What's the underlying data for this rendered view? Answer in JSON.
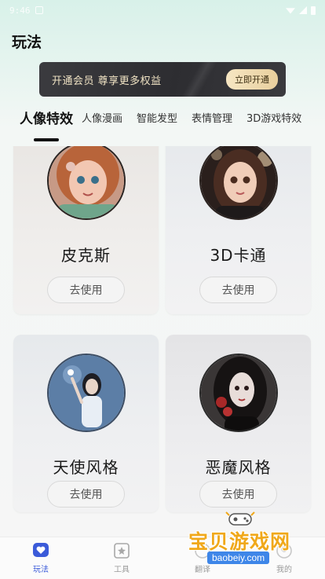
{
  "status_bar": {
    "time": "9:46"
  },
  "header": {
    "title": "玩法"
  },
  "vip_banner": {
    "text": "开通会员  尊享更多权益",
    "button_label": "立即开通"
  },
  "tabs": [
    {
      "label": "人像特效",
      "active": true
    },
    {
      "label": "人像漫画"
    },
    {
      "label": "智能发型"
    },
    {
      "label": "表情管理"
    },
    {
      "label": "3D游戏特效"
    }
  ],
  "cards": [
    {
      "title": "皮克斯",
      "button": "去使用"
    },
    {
      "title": "3D卡通",
      "button": "去使用"
    },
    {
      "title": "天使风格",
      "button": "去使用"
    },
    {
      "title": "恶魔风格",
      "button": "去使用"
    }
  ],
  "bottom_nav": [
    {
      "label": "玩法",
      "icon": "heart-chat-icon",
      "active": true
    },
    {
      "label": "工具",
      "icon": "toolbox-icon"
    },
    {
      "label": "翻译",
      "icon": "translate-icon"
    },
    {
      "label": "我的",
      "icon": "profile-icon"
    }
  ],
  "watermark": {
    "title": "宝贝游戏网",
    "url": "baobeiy.com"
  },
  "colors": {
    "accent": "#3b5bd9",
    "banner_bg": "#2f2f33",
    "banner_button": "#eed8ad"
  }
}
